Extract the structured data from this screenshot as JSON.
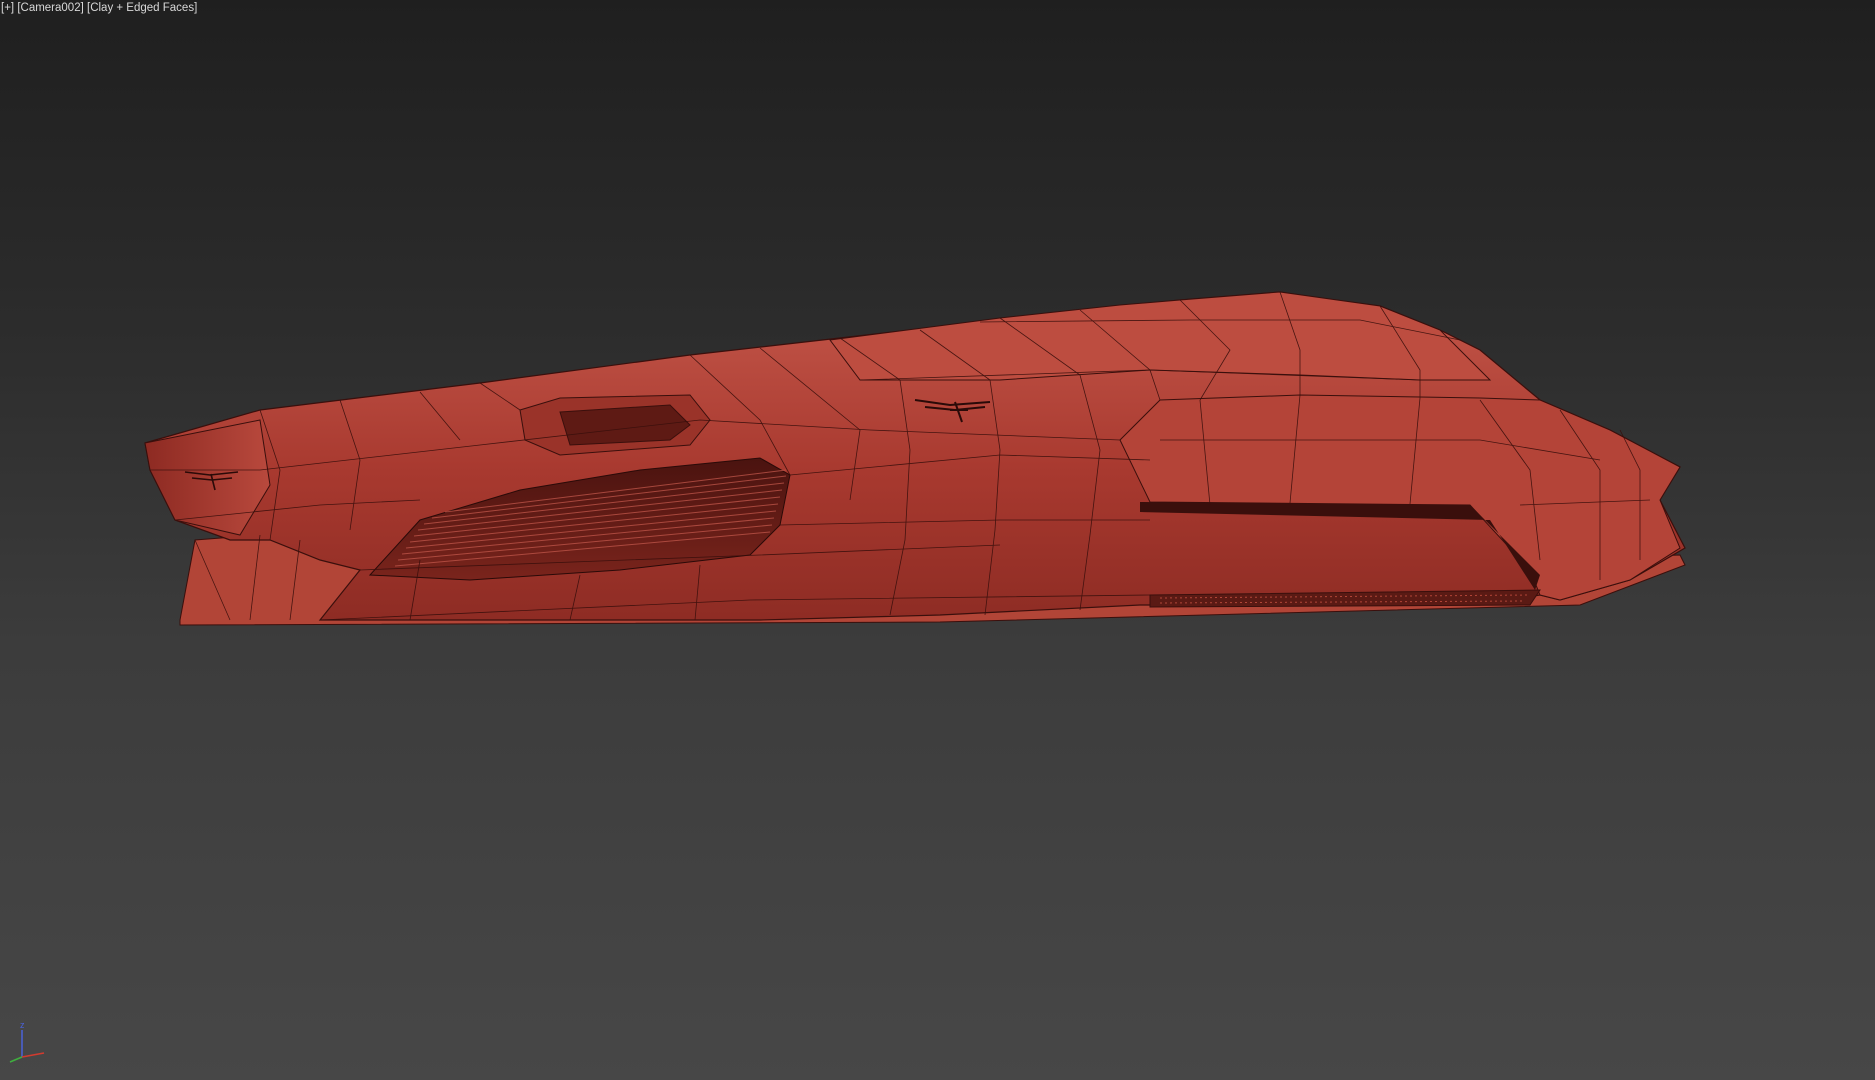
{
  "viewport": {
    "menu_label": "[+]",
    "camera_label": "[Camera002]",
    "shading_label": "[Clay + Edged Faces]"
  },
  "scene": {
    "object": "spaceship-mesh",
    "clay_color": "#b5463a",
    "edge_color": "#3a0f0c",
    "background_top": "#1f1f1f",
    "background_bottom": "#474747"
  },
  "axis_gizmo": {
    "z_label": "z",
    "x_color": "#d23b2f",
    "y_color": "#3fae3f",
    "z_color": "#4a62d8"
  }
}
